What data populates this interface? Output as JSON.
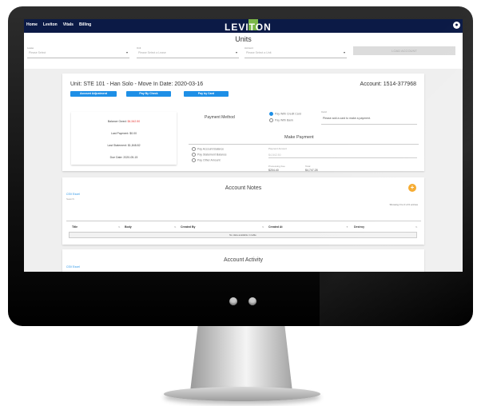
{
  "nav": [
    "Home",
    "Leviton",
    "Vitals",
    "Billing"
  ],
  "brand": "LEVITON",
  "page_title": "Units",
  "filters": [
    {
      "label": "Lease",
      "placeholder": "Please Select"
    },
    {
      "label": "Unit",
      "placeholder": "Please Select a Lease"
    },
    {
      "label": "Account",
      "placeholder": "Please Select a Unit"
    }
  ],
  "load_button": "LOAD ACCOUNT",
  "unit_card": {
    "title": "Unit: STE 101 - Han Solo - Move In Date: 2020-03-16",
    "account": "Account: 1514-377968",
    "buttons": [
      "Account Adjustment",
      "Pay By Check",
      "Pay by Card"
    ],
    "balance_label": "Balance Owed:",
    "balance_value": "$4,542.50",
    "last_payment": "Last Payment: $0.00",
    "last_statement": "Last Statement: $1,848.82",
    "due_date": "Due Date: 2020-05-15",
    "payment_method_title": "Payment Method",
    "method_options": [
      "Pay With Credit Card",
      "Pay With Bank"
    ],
    "card_label": "Card",
    "card_message": "Please add a card to make a payment.",
    "make_payment_title": "Make Payment",
    "amount_options": [
      "Pay Account Balance",
      "Pay Statement Balance",
      "Pay Other Amount"
    ],
    "payment_amount_label": "Payment Amount",
    "payment_amount_value": "$4,542.50",
    "processing_fee_label": "Processing Fee",
    "processing_fee_value": "$204.40",
    "total_label": "Total",
    "total_value": "$4,747.28"
  },
  "notes_card": {
    "title": "Account Notes",
    "export_links": "CSV Excel",
    "search_label": "Search:",
    "showing": "Showing 0 to 0 of 0 entries",
    "columns": [
      "Title",
      "Body",
      "Created By",
      "Created At",
      "Destroy"
    ],
    "empty_text": "No data available in table"
  },
  "activity_card": {
    "title": "Account Activity",
    "export_links": "CSV Excel"
  },
  "colors": {
    "navbar": "#0b1a46",
    "accent": "#1e8fe6",
    "brand_green": "#7ab648",
    "add_button": "#f5a623",
    "balance_red": "#e53935"
  }
}
